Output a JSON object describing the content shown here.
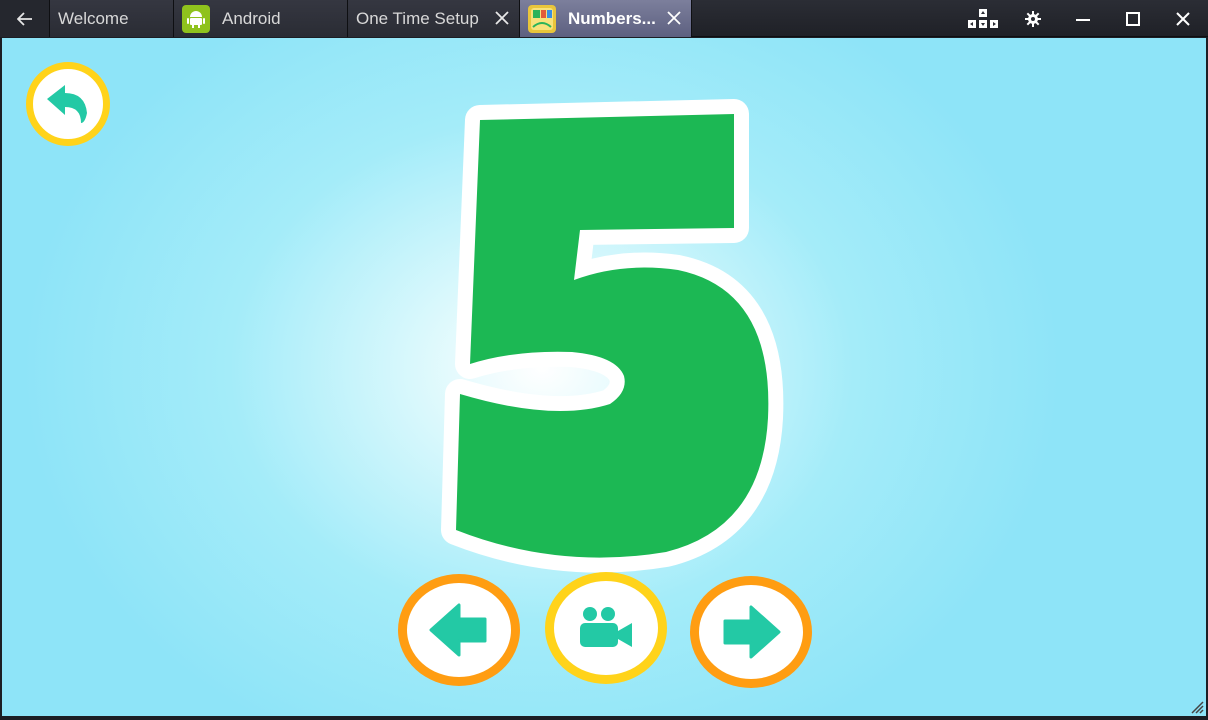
{
  "window": {
    "tabs": [
      {
        "label": "Welcome",
        "closable": false,
        "active": false
      },
      {
        "label": "Android",
        "closable": false,
        "active": false,
        "icon": "android-icon"
      },
      {
        "label": "One Time Setup",
        "closable": true,
        "active": false
      },
      {
        "label": "Numbers...",
        "closable": true,
        "active": true,
        "icon": "numbers-app-icon"
      }
    ],
    "controls": [
      "keyboard-controls-icon",
      "gear-icon",
      "minimize-icon",
      "maximize-icon",
      "close-icon"
    ]
  },
  "app": {
    "current_number": "5",
    "buttons": [
      "back-arrow-icon",
      "previous-arrow-icon",
      "video-camera-icon",
      "next-arrow-icon"
    ]
  },
  "colors": {
    "digit_fill": "#1cb854",
    "icon_teal": "#23c9a5",
    "ring_yellow": "#ffd31a",
    "ring_orange": "#ff9d12",
    "active_tab": "#6b6e8e",
    "background_sky": "#8ee4f8"
  }
}
